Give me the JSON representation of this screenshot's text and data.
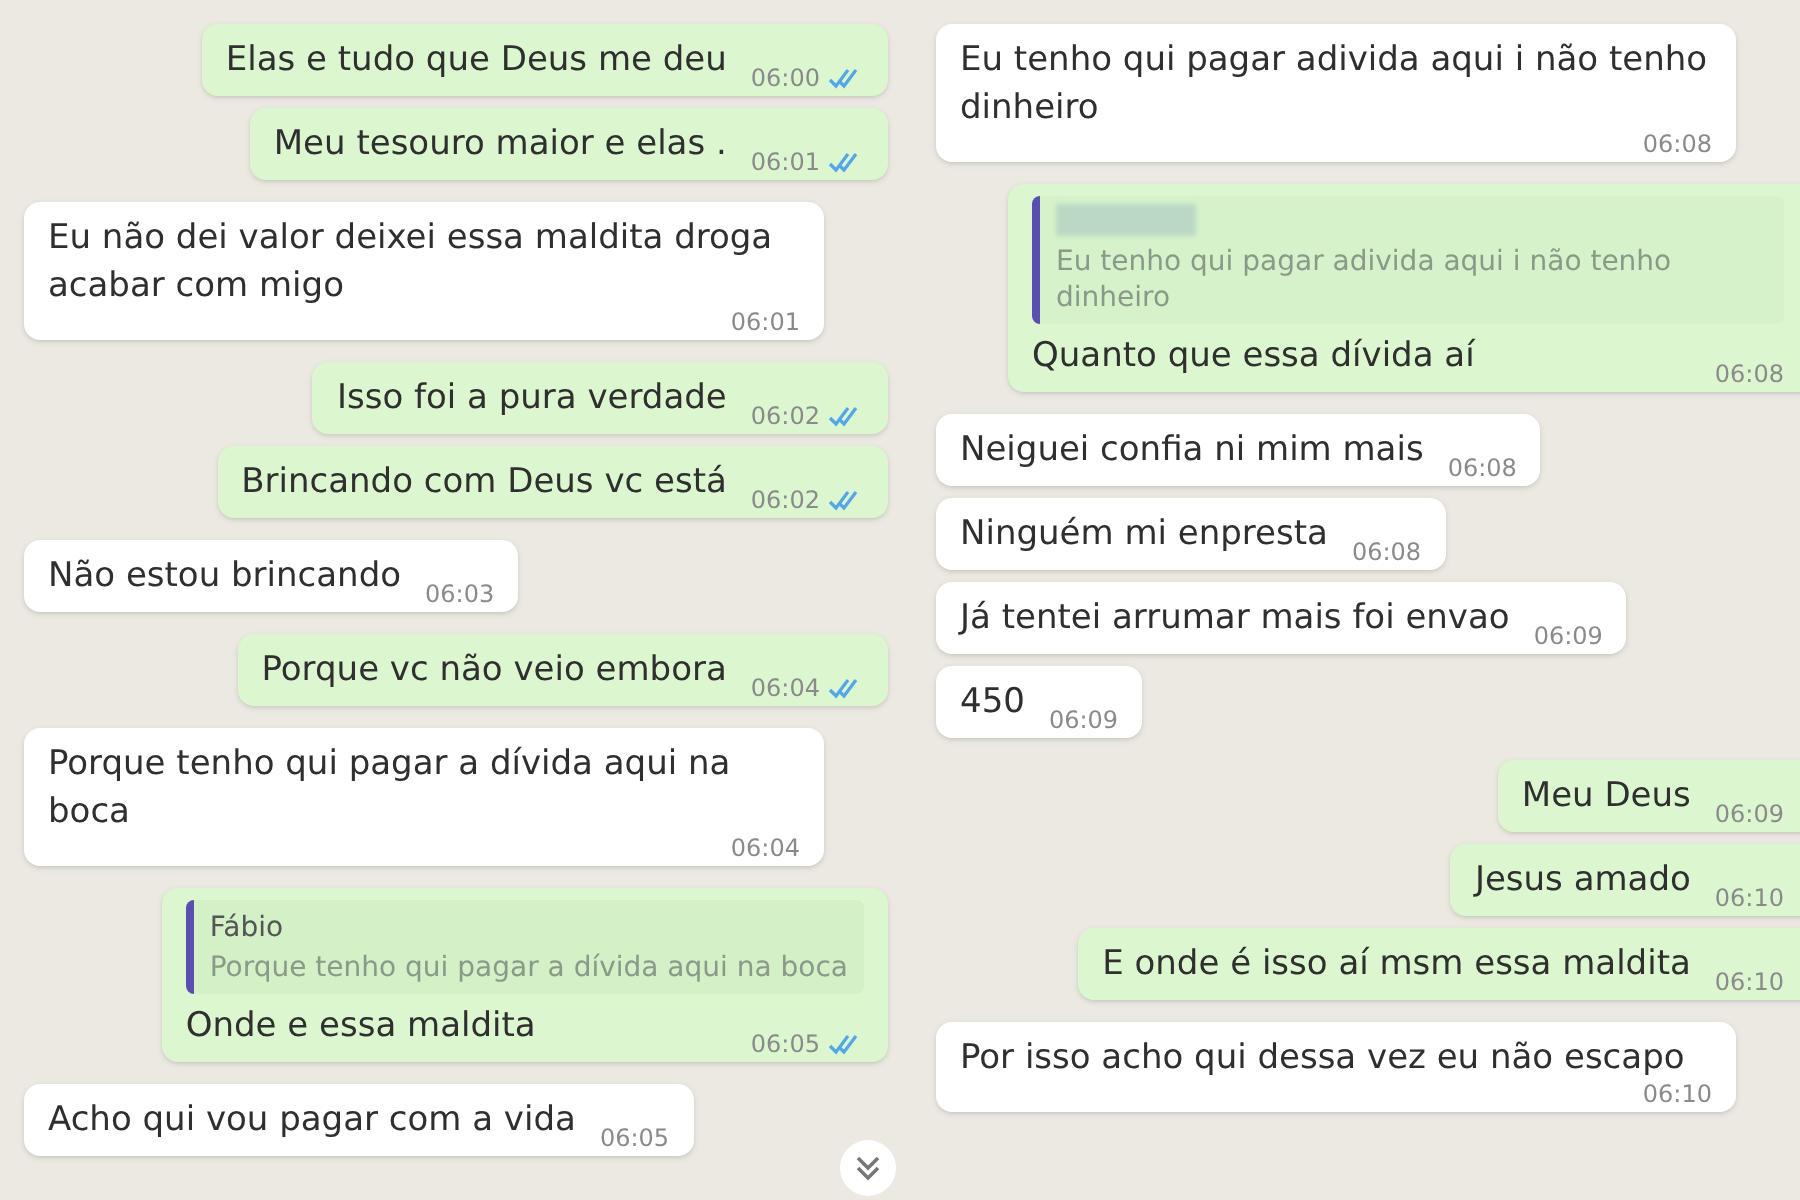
{
  "panels": [
    {
      "messages": [
        {
          "kind": "outgoing",
          "text": "Elas e tudo que Deus me deu",
          "time": "06:00",
          "ticks": true
        },
        {
          "kind": "outgoing",
          "text": "Meu tesouro maior e elas .",
          "time": "06:01",
          "ticks": true
        },
        {
          "kind": "incoming",
          "text": "Eu não dei valor deixei essa maldita droga acabar com migo",
          "time": "06:01"
        },
        {
          "kind": "outgoing",
          "text": "Isso foi a pura verdade",
          "time": "06:02",
          "ticks": true
        },
        {
          "kind": "outgoing",
          "text": "Brincando com Deus vc está",
          "time": "06:02",
          "ticks": true
        },
        {
          "kind": "incoming",
          "text": "Não estou brincando",
          "time": "06:03"
        },
        {
          "kind": "outgoing",
          "text": "Porque vc não veio embora",
          "time": "06:04",
          "ticks": true
        },
        {
          "kind": "incoming",
          "text": "Porque tenho qui pagar a dívida aqui na boca",
          "time": "06:04"
        },
        {
          "kind": "outgoing",
          "reply": {
            "name": "Fábio",
            "text": "Porque tenho qui pagar a dívida aqui na boca",
            "redacted": false
          },
          "text": "Onde e essa maldita",
          "time": "06:05",
          "ticks": true
        },
        {
          "kind": "incoming",
          "text": "Acho qui vou pagar com a vida",
          "time": "06:05"
        }
      ],
      "scroll_button": true
    },
    {
      "messages": [
        {
          "kind": "incoming",
          "text": "Eu tenho qui pagar adivida aqui i não tenho dinheiro",
          "time": "06:08"
        },
        {
          "kind": "outgoing",
          "reply": {
            "text": "Eu tenho qui pagar adivida aqui i não tenho dinheiro",
            "redacted": true
          },
          "text": "Quanto que essa dívida aí",
          "time": "06:08",
          "ticks": false
        },
        {
          "kind": "incoming",
          "text": "Neiguei confia ni mim mais",
          "time": "06:08"
        },
        {
          "kind": "incoming",
          "text": "Ninguém mi enpresta",
          "time": "06:08"
        },
        {
          "kind": "incoming",
          "text": "Já tentei arrumar mais foi envao",
          "time": "06:09"
        },
        {
          "kind": "incoming",
          "text": "450",
          "time": "06:09"
        },
        {
          "kind": "outgoing",
          "text": "Meu Deus",
          "time": "06:09",
          "ticks": false
        },
        {
          "kind": "outgoing",
          "text": "Jesus amado",
          "time": "06:10",
          "ticks": false
        },
        {
          "kind": "outgoing",
          "text": "E onde é isso aí msm essa maldita",
          "time": "06:10",
          "ticks": false
        },
        {
          "kind": "incoming",
          "text": "Por isso acho qui dessa vez eu não escapo",
          "time": "06:10"
        }
      ],
      "scroll_button": false
    }
  ]
}
